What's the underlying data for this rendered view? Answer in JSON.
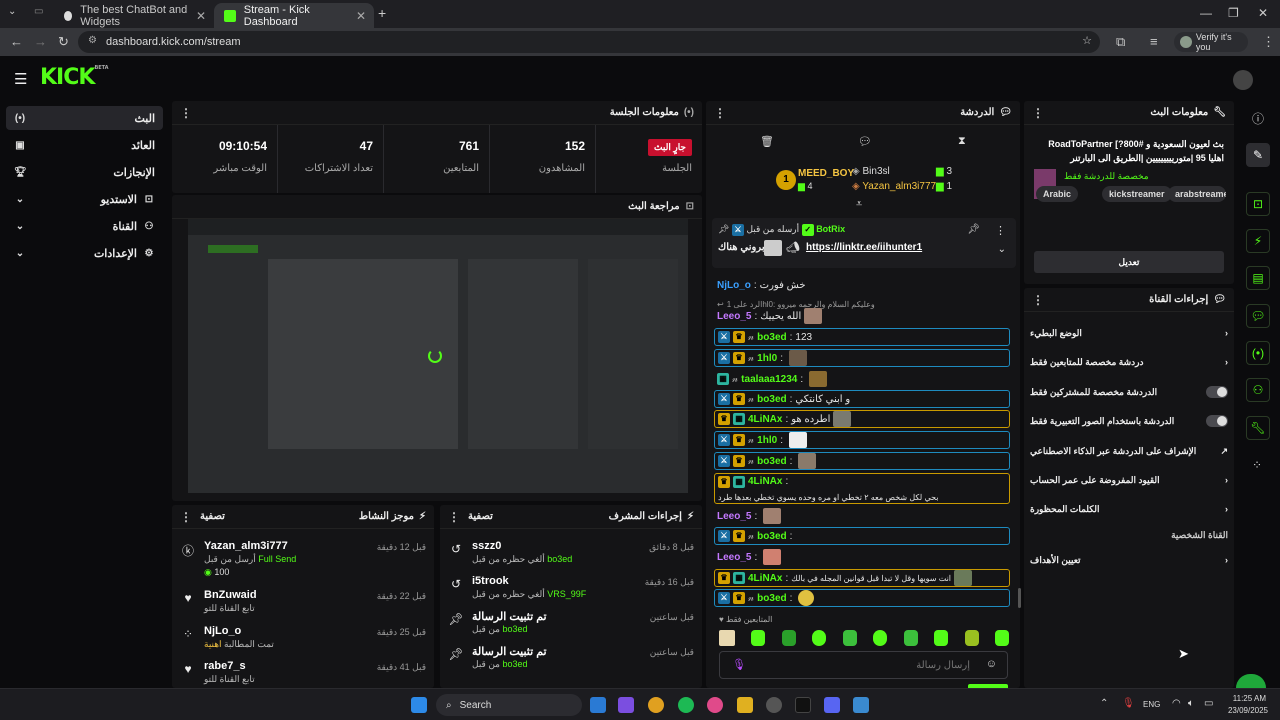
{
  "browser": {
    "tabs": [
      {
        "title": "The best ChatBot and Widgets",
        "active": false
      },
      {
        "title": "Stream - Kick Dashboard",
        "active": true
      }
    ],
    "url": "dashboard.kick.com/stream",
    "verify_label": "Verify it's you"
  },
  "app": {
    "logo": "KICK",
    "logo_beta": "BETA"
  },
  "nav": {
    "items": [
      {
        "label": "البث",
        "icon": "broadcast-icon",
        "active": true
      },
      {
        "label": "العائد",
        "icon": "revenue-icon"
      },
      {
        "label": "الإنجازات",
        "icon": "trophy-icon"
      },
      {
        "label": "الاستديو",
        "icon": "studio-icon"
      },
      {
        "label": "القناة",
        "icon": "channel-icon"
      },
      {
        "label": "الإعدادات",
        "icon": "settings-icon"
      }
    ]
  },
  "session": {
    "title": "معلومات الجلسة",
    "live_badge": "جارٍ البث",
    "session_label": "الجلسة",
    "stats": [
      {
        "value": "152",
        "label": "المشاهدون"
      },
      {
        "value": "761",
        "label": "المتابعين"
      },
      {
        "value": "47",
        "label": "تعداد الاشتراكات"
      },
      {
        "value": "09:10:54",
        "label": "الوقت مباشر"
      }
    ]
  },
  "preview": {
    "title": "مراجعة البث"
  },
  "activity": {
    "title": "موجز النشاط",
    "filter": "تصفية",
    "rows": [
      {
        "name": "Yazan_alm3i777",
        "sub": "أرسل من قبل",
        "sub_hl": "Full Send",
        "extra": "100",
        "time": "قبل 12 دقيقة",
        "icon": "kick-icon"
      },
      {
        "name": "BnZuwaid",
        "sub": "تابع القناة للتو",
        "sub_hl": "",
        "extra": "",
        "time": "قبل 22 دقيقة",
        "icon": "heart-icon"
      },
      {
        "name": "NjLo_o",
        "sub": "تمت المطالبة",
        "sub_hl": "اهنية",
        "extra": "",
        "time": "قبل 25 دقيقة",
        "icon": "dots-icon"
      },
      {
        "name": "rabe7_s",
        "sub": "تابع القناة للتو",
        "sub_hl": "",
        "extra": "",
        "time": "قبل 41 دقيقة",
        "icon": "heart-icon"
      }
    ]
  },
  "modactions": {
    "title": "إجراءات المشرف",
    "filter": "تصفية",
    "rows": [
      {
        "name": "sszz0",
        "sub": "ألغي حظره من قبل",
        "sub_hl": "bo3ed",
        "time": "قبل 8 دقائق",
        "icon": "undo-icon"
      },
      {
        "name": "i5trook",
        "sub": "ألغي حظره من قبل",
        "sub_hl": "VRS_99F",
        "time": "قبل 16 دقيقة",
        "icon": "undo-icon"
      },
      {
        "name": "تم تثبيت الرسالة",
        "sub": "من قبل",
        "sub_hl": "bo3ed",
        "time": "قبل ساعتين",
        "icon": "pin-icon"
      },
      {
        "name": "تم تثبيت الرسالة",
        "sub": "من قبل",
        "sub_hl": "bo3ed",
        "time": "قبل ساعتين",
        "icon": "pin-icon"
      }
    ]
  },
  "chat": {
    "title": "الدردشة",
    "leaders": [
      {
        "name": "MEED_BOY",
        "count": "4",
        "rank": "1"
      },
      {
        "name": "Bin3sl",
        "count": "3"
      },
      {
        "name": "Yazan_alm3i777",
        "count": "1"
      }
    ],
    "pinned": {
      "by_label": "أرسله من قبل",
      "by_user": "BotRix",
      "text": "تابروني هناك",
      "link": "https://linktr.ee/iihunter1"
    },
    "messages": [
      {
        "user": "NjLo_o",
        "text": "خش فورت",
        "style": "plain",
        "color": "#3aa0ff"
      },
      {
        "user": "",
        "text": "الرد على 1hl0: وعليكم السلام والرحمه ميروو",
        "style": "reply",
        "color": "#999"
      },
      {
        "user": "Leeo_5",
        "text": "الله يحييك",
        "style": "plain",
        "color": "#c479ff"
      },
      {
        "user": "bo3ed",
        "text": "123",
        "style": "mod",
        "color": "#53fc18"
      },
      {
        "user": "1hl0",
        "text": "",
        "style": "mod",
        "color": "#53fc18"
      },
      {
        "user": "taalaaa1234",
        "text": "",
        "style": "grn",
        "color": "#53fc18"
      },
      {
        "user": "bo3ed",
        "text": "و ابني كانتكي",
        "style": "mod",
        "color": "#53fc18"
      },
      {
        "user": "4LiNAx",
        "text": "اطرده هو",
        "style": "vip",
        "color": "#53fc18"
      },
      {
        "user": "1hl0",
        "text": "",
        "style": "mod",
        "color": "#53fc18"
      },
      {
        "user": "bo3ed",
        "text": "",
        "style": "mod",
        "color": "#53fc18"
      },
      {
        "user": "4LiNAx",
        "text": "بحي لكل شخص معه ٢ تخطي او مره وحده يسوي تخطي بعدها طرد",
        "style": "vip",
        "color": "#53fc18"
      },
      {
        "user": "Leeo_5",
        "text": "",
        "style": "plain",
        "color": "#c479ff"
      },
      {
        "user": "bo3ed",
        "text": "",
        "style": "mod",
        "color": "#53fc18"
      },
      {
        "user": "Leeo_5",
        "text": "",
        "style": "plain",
        "color": "#c479ff"
      },
      {
        "user": "4LiNAx",
        "text": "انت سويها وقل لا تبدا قبل قوانين المجله في بالك",
        "style": "vip",
        "color": "#53fc18"
      },
      {
        "user": "bo3ed",
        "text": "",
        "style": "mod",
        "color": "#53fc18"
      }
    ],
    "followers_only": "المتابعين فقط",
    "input_placeholder": "إرسال رسالة"
  },
  "stream_info": {
    "title": "معلومات البث",
    "stream_title": "بث لعيون السعودية و #RoadToPartner [?800 اهليا 95 |متوريييييييين |الطريق الى البارتنر",
    "category_label": "مخصصة للدردشة فقط",
    "tags": [
      "Arabic",
      "kickstreamer",
      "arabstreame"
    ],
    "edit_button": "تعديل"
  },
  "channel_actions": {
    "title": "إجراءات القناة",
    "rows": [
      {
        "label": "الوضع البطيء",
        "control": "chevron"
      },
      {
        "label": "دردشة مخصصة للمتابعين فقط",
        "control": "chevron"
      },
      {
        "label": "الدردشة مخصصة للمشتركين فقط",
        "control": "toggle"
      },
      {
        "label": "الدردشة باستخدام الصور التعبيرية فقط",
        "control": "toggle"
      },
      {
        "label": "الإشراف على الدردشة عبر الذكاء الاصطناعي",
        "control": "external"
      },
      {
        "label": "القيود المفروضة على عمر الحساب",
        "control": "chevron"
      },
      {
        "label": "الكلمات المحظورة",
        "control": "chevron"
      }
    ],
    "section_personal": "القناة الشخصية",
    "goals_row": "تعيين الأهداف"
  },
  "taskbar": {
    "search": "Search",
    "lang": "ENG",
    "time": "11:25 AM",
    "date": "23/09/2025"
  },
  "colors": {
    "accent": "#53fc18",
    "live": "#c8102e",
    "mod_border": "#1e8bbf",
    "vip_border": "#c99a00"
  }
}
